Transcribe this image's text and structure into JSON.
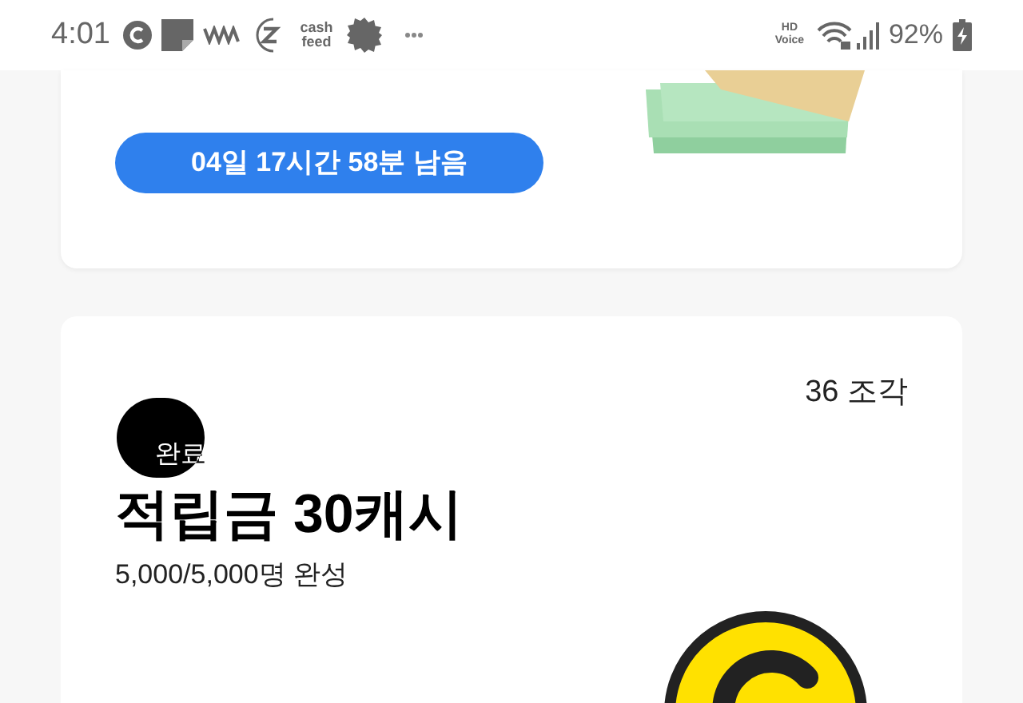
{
  "status_bar": {
    "time": "4:01",
    "cash_feed_logo": "cash feed",
    "hd_voice": "HD Voice",
    "battery": "92%"
  },
  "cards": [
    {
      "kind": "timer",
      "countdown": "04일 17시간 58분 남음"
    },
    {
      "kind": "reward",
      "pieces": "36 조각",
      "badge": "완료",
      "title": "적립금 30캐시",
      "progress_text": "5,000/5,000명 완성"
    }
  ]
}
